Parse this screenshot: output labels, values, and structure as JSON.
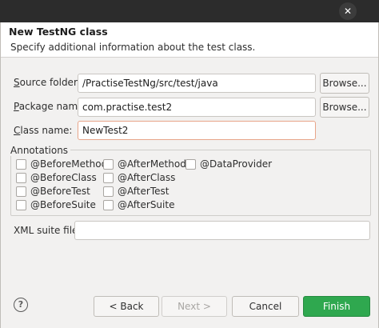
{
  "window": {
    "close_glyph": "✕",
    "title": "New TestNG class",
    "description": "Specify additional information about the test class."
  },
  "form": {
    "source_folder": {
      "label_mnemonic": "S",
      "label_rest": "ource folder:",
      "value": "/PractiseTestNg/src/test/java",
      "browse_label": "Browse..."
    },
    "package_name": {
      "label_mnemonic": "P",
      "label_rest": "ackage name:",
      "value": "com.practise.test2",
      "browse_label": "Browse..."
    },
    "class_name": {
      "label_mnemonic": "C",
      "label_rest": "lass name:",
      "value": "NewTest2"
    },
    "xml_suite_file": {
      "label": "XML suite file:",
      "value": ""
    }
  },
  "annotations": {
    "legend": "Annotations",
    "items": [
      {
        "label": "@BeforeMethod",
        "checked": false
      },
      {
        "label": "@AfterMethod",
        "checked": false
      },
      {
        "label": "@DataProvider",
        "checked": false
      },
      {
        "label": "@BeforeClass",
        "checked": false
      },
      {
        "label": "@AfterClass",
        "checked": false
      },
      {
        "label": "@BeforeTest",
        "checked": false
      },
      {
        "label": "@AfterTest",
        "checked": false
      },
      {
        "label": "@BeforeSuite",
        "checked": false
      },
      {
        "label": "@AfterSuite",
        "checked": false
      }
    ]
  },
  "footer": {
    "help_glyph": "?",
    "back_label": "< Back",
    "next_label": "Next >",
    "cancel_label": "Cancel",
    "finish_label": "Finish"
  },
  "colors": {
    "finish_button": "#2fa84f",
    "focus_border": "#e8a58a"
  },
  "icons": {
    "close": "close-icon",
    "help": "help-icon"
  }
}
